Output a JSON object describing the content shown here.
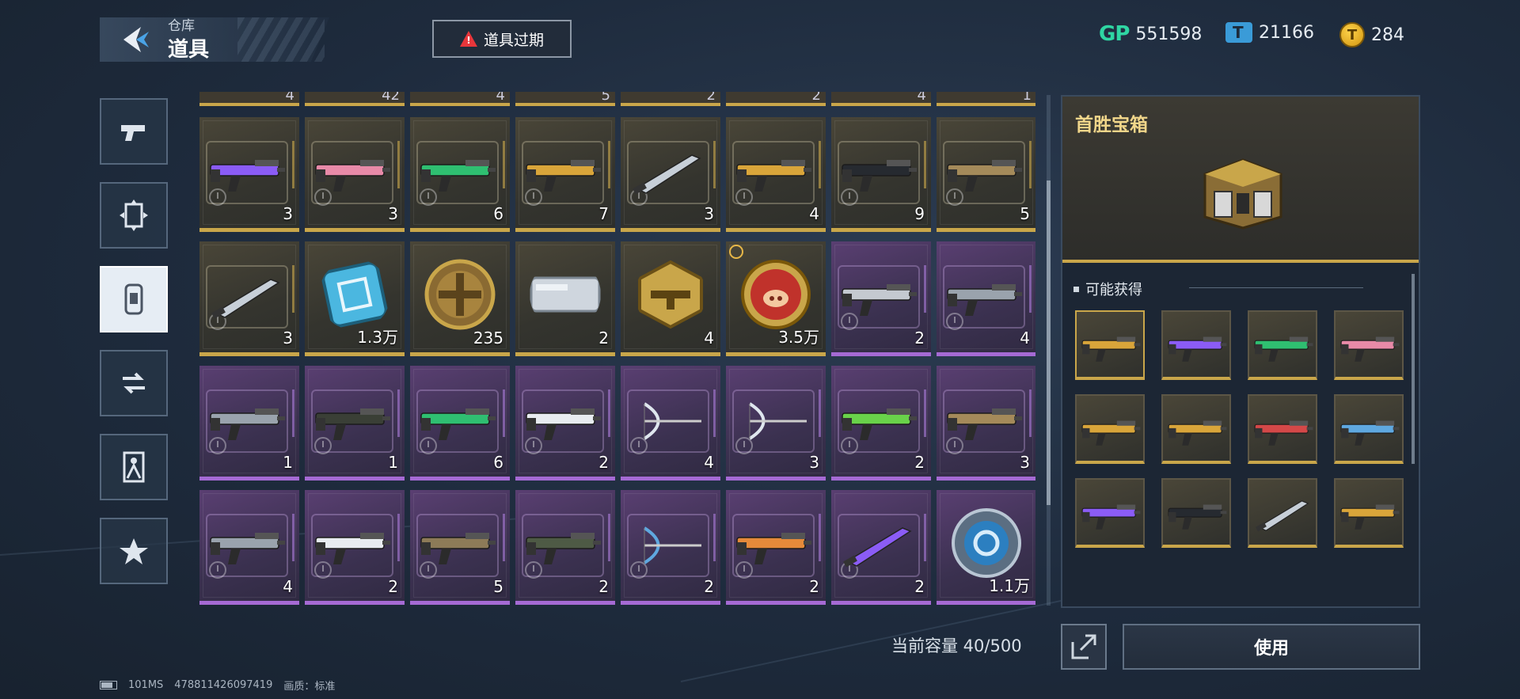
{
  "header": {
    "breadcrumb": "仓库",
    "title": "道具",
    "expire_button": "道具过期"
  },
  "currencies": [
    {
      "icon": "gp-icon",
      "label": "GP",
      "value": "551598"
    },
    {
      "icon": "ticket-icon",
      "value": "21166"
    },
    {
      "icon": "coin-icon",
      "value": "284"
    }
  ],
  "side_tabs": [
    {
      "icon": "pistol-icon",
      "active": false
    },
    {
      "icon": "frame-icon",
      "active": false
    },
    {
      "icon": "item-card-icon",
      "active": true
    },
    {
      "icon": "transfer-icon",
      "active": false
    },
    {
      "icon": "character-icon",
      "active": false
    },
    {
      "icon": "star-icon",
      "active": false
    }
  ],
  "partial_row_quantities": [
    "4",
    "42",
    "4",
    "5",
    "2",
    "2",
    "4",
    "1"
  ],
  "grid": [
    [
      {
        "qty": "3",
        "rarity": "gold",
        "icon": "purple-rifle-icon"
      },
      {
        "qty": "3",
        "rarity": "gold",
        "icon": "pink-rifle-icon"
      },
      {
        "qty": "6",
        "rarity": "gold",
        "icon": "green-rifle-icon"
      },
      {
        "qty": "7",
        "rarity": "gold",
        "icon": "gold-rifle-icon"
      },
      {
        "qty": "3",
        "rarity": "gold",
        "icon": "knife-icon"
      },
      {
        "qty": "4",
        "rarity": "gold",
        "icon": "gold-sniper-icon"
      },
      {
        "qty": "9",
        "rarity": "gold",
        "icon": "black-sniper-icon"
      },
      {
        "qty": "5",
        "rarity": "gold",
        "icon": "tan-rifle-icon"
      }
    ],
    [
      {
        "qty": "3",
        "rarity": "gold",
        "icon": "sword-icon"
      },
      {
        "qty": "1.3万",
        "rarity": "gold",
        "icon": "chip-card-icon"
      },
      {
        "qty": "235",
        "rarity": "gold",
        "icon": "bronze-medal-icon"
      },
      {
        "qty": "2",
        "rarity": "gold",
        "icon": "silver-case-icon"
      },
      {
        "qty": "4",
        "rarity": "gold",
        "icon": "gold-hex-badge-icon"
      },
      {
        "qty": "3.5万",
        "rarity": "gold",
        "icon": "pig-coin-icon",
        "timer": true
      },
      {
        "qty": "2",
        "rarity": "epic",
        "icon": "silver-rifle-icon"
      },
      {
        "qty": "4",
        "rarity": "epic",
        "icon": "gatling-icon"
      }
    ],
    [
      {
        "qty": "1",
        "rarity": "epic",
        "icon": "smg-icon"
      },
      {
        "qty": "1",
        "rarity": "epic",
        "icon": "dark-rifle-icon"
      },
      {
        "qty": "6",
        "rarity": "epic",
        "icon": "green-rifle-icon"
      },
      {
        "qty": "2",
        "rarity": "epic",
        "icon": "white-smg-icon"
      },
      {
        "qty": "4",
        "rarity": "epic",
        "icon": "crossbow-icon"
      },
      {
        "qty": "3",
        "rarity": "epic",
        "icon": "bow-icon"
      },
      {
        "qty": "2",
        "rarity": "epic",
        "icon": "neon-green-rifle-icon"
      },
      {
        "qty": "3",
        "rarity": "epic",
        "icon": "tan-pistol-icon"
      }
    ],
    [
      {
        "qty": "4",
        "rarity": "epic",
        "icon": "heavy-rifle-icon"
      },
      {
        "qty": "2",
        "rarity": "epic",
        "icon": "white-rifle-icon"
      },
      {
        "qty": "5",
        "rarity": "epic",
        "icon": "desert-rifle-icon"
      },
      {
        "qty": "2",
        "rarity": "epic",
        "icon": "camo-rifle-icon"
      },
      {
        "qty": "2",
        "rarity": "epic",
        "icon": "blue-crossbow-icon"
      },
      {
        "qty": "2",
        "rarity": "epic",
        "icon": "orange-smg-icon"
      },
      {
        "qty": "2",
        "rarity": "epic",
        "icon": "purple-blade-icon"
      },
      {
        "qty": "1.1万",
        "rarity": "epic",
        "icon": "blue-token-icon"
      }
    ]
  ],
  "capacity": "当前容量 40/500",
  "detail": {
    "title": "首胜宝箱",
    "drops_label": "可能获得",
    "use_button": "使用",
    "drops": [
      {
        "icon": "mystery-gold-rifle-icon"
      },
      {
        "icon": "purple-rifle-icon"
      },
      {
        "icon": "green-rifle-icon"
      },
      {
        "icon": "pink-rifle-icon"
      },
      {
        "icon": "gold-pistol-icon"
      },
      {
        "icon": "black-gold-rifle-icon"
      },
      {
        "icon": "red-rifle-icon"
      },
      {
        "icon": "blue-orange-rifle-icon"
      },
      {
        "icon": "purple-white-rifle-icon"
      },
      {
        "icon": "black-red-rifle-icon"
      },
      {
        "icon": "knife-icon"
      },
      {
        "icon": "gold-smg-icon"
      }
    ]
  },
  "footer": {
    "ping": "101MS",
    "uid": "478811426097419",
    "quality": "画质：标准"
  },
  "colors": {
    "gold_rarity": "#c9a64a",
    "epic_rarity": "#a56ad4",
    "accent_title": "#f1d68a",
    "warning": "#e8363b"
  }
}
